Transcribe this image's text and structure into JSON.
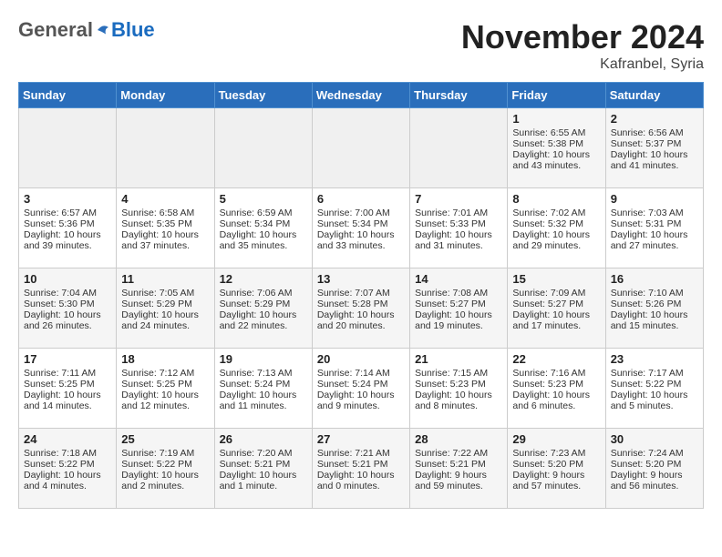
{
  "header": {
    "logo_general": "General",
    "logo_blue": "Blue",
    "month_title": "November 2024",
    "location": "Kafranbel, Syria"
  },
  "weekdays": [
    "Sunday",
    "Monday",
    "Tuesday",
    "Wednesday",
    "Thursday",
    "Friday",
    "Saturday"
  ],
  "weeks": [
    [
      {
        "day": "",
        "info": ""
      },
      {
        "day": "",
        "info": ""
      },
      {
        "day": "",
        "info": ""
      },
      {
        "day": "",
        "info": ""
      },
      {
        "day": "",
        "info": ""
      },
      {
        "day": "1",
        "info": "Sunrise: 6:55 AM\nSunset: 5:38 PM\nDaylight: 10 hours and 43 minutes."
      },
      {
        "day": "2",
        "info": "Sunrise: 6:56 AM\nSunset: 5:37 PM\nDaylight: 10 hours and 41 minutes."
      }
    ],
    [
      {
        "day": "3",
        "info": "Sunrise: 6:57 AM\nSunset: 5:36 PM\nDaylight: 10 hours and 39 minutes."
      },
      {
        "day": "4",
        "info": "Sunrise: 6:58 AM\nSunset: 5:35 PM\nDaylight: 10 hours and 37 minutes."
      },
      {
        "day": "5",
        "info": "Sunrise: 6:59 AM\nSunset: 5:34 PM\nDaylight: 10 hours and 35 minutes."
      },
      {
        "day": "6",
        "info": "Sunrise: 7:00 AM\nSunset: 5:34 PM\nDaylight: 10 hours and 33 minutes."
      },
      {
        "day": "7",
        "info": "Sunrise: 7:01 AM\nSunset: 5:33 PM\nDaylight: 10 hours and 31 minutes."
      },
      {
        "day": "8",
        "info": "Sunrise: 7:02 AM\nSunset: 5:32 PM\nDaylight: 10 hours and 29 minutes."
      },
      {
        "day": "9",
        "info": "Sunrise: 7:03 AM\nSunset: 5:31 PM\nDaylight: 10 hours and 27 minutes."
      }
    ],
    [
      {
        "day": "10",
        "info": "Sunrise: 7:04 AM\nSunset: 5:30 PM\nDaylight: 10 hours and 26 minutes."
      },
      {
        "day": "11",
        "info": "Sunrise: 7:05 AM\nSunset: 5:29 PM\nDaylight: 10 hours and 24 minutes."
      },
      {
        "day": "12",
        "info": "Sunrise: 7:06 AM\nSunset: 5:29 PM\nDaylight: 10 hours and 22 minutes."
      },
      {
        "day": "13",
        "info": "Sunrise: 7:07 AM\nSunset: 5:28 PM\nDaylight: 10 hours and 20 minutes."
      },
      {
        "day": "14",
        "info": "Sunrise: 7:08 AM\nSunset: 5:27 PM\nDaylight: 10 hours and 19 minutes."
      },
      {
        "day": "15",
        "info": "Sunrise: 7:09 AM\nSunset: 5:27 PM\nDaylight: 10 hours and 17 minutes."
      },
      {
        "day": "16",
        "info": "Sunrise: 7:10 AM\nSunset: 5:26 PM\nDaylight: 10 hours and 15 minutes."
      }
    ],
    [
      {
        "day": "17",
        "info": "Sunrise: 7:11 AM\nSunset: 5:25 PM\nDaylight: 10 hours and 14 minutes."
      },
      {
        "day": "18",
        "info": "Sunrise: 7:12 AM\nSunset: 5:25 PM\nDaylight: 10 hours and 12 minutes."
      },
      {
        "day": "19",
        "info": "Sunrise: 7:13 AM\nSunset: 5:24 PM\nDaylight: 10 hours and 11 minutes."
      },
      {
        "day": "20",
        "info": "Sunrise: 7:14 AM\nSunset: 5:24 PM\nDaylight: 10 hours and 9 minutes."
      },
      {
        "day": "21",
        "info": "Sunrise: 7:15 AM\nSunset: 5:23 PM\nDaylight: 10 hours and 8 minutes."
      },
      {
        "day": "22",
        "info": "Sunrise: 7:16 AM\nSunset: 5:23 PM\nDaylight: 10 hours and 6 minutes."
      },
      {
        "day": "23",
        "info": "Sunrise: 7:17 AM\nSunset: 5:22 PM\nDaylight: 10 hours and 5 minutes."
      }
    ],
    [
      {
        "day": "24",
        "info": "Sunrise: 7:18 AM\nSunset: 5:22 PM\nDaylight: 10 hours and 4 minutes."
      },
      {
        "day": "25",
        "info": "Sunrise: 7:19 AM\nSunset: 5:22 PM\nDaylight: 10 hours and 2 minutes."
      },
      {
        "day": "26",
        "info": "Sunrise: 7:20 AM\nSunset: 5:21 PM\nDaylight: 10 hours and 1 minute."
      },
      {
        "day": "27",
        "info": "Sunrise: 7:21 AM\nSunset: 5:21 PM\nDaylight: 10 hours and 0 minutes."
      },
      {
        "day": "28",
        "info": "Sunrise: 7:22 AM\nSunset: 5:21 PM\nDaylight: 9 hours and 59 minutes."
      },
      {
        "day": "29",
        "info": "Sunrise: 7:23 AM\nSunset: 5:20 PM\nDaylight: 9 hours and 57 minutes."
      },
      {
        "day": "30",
        "info": "Sunrise: 7:24 AM\nSunset: 5:20 PM\nDaylight: 9 hours and 56 minutes."
      }
    ]
  ]
}
